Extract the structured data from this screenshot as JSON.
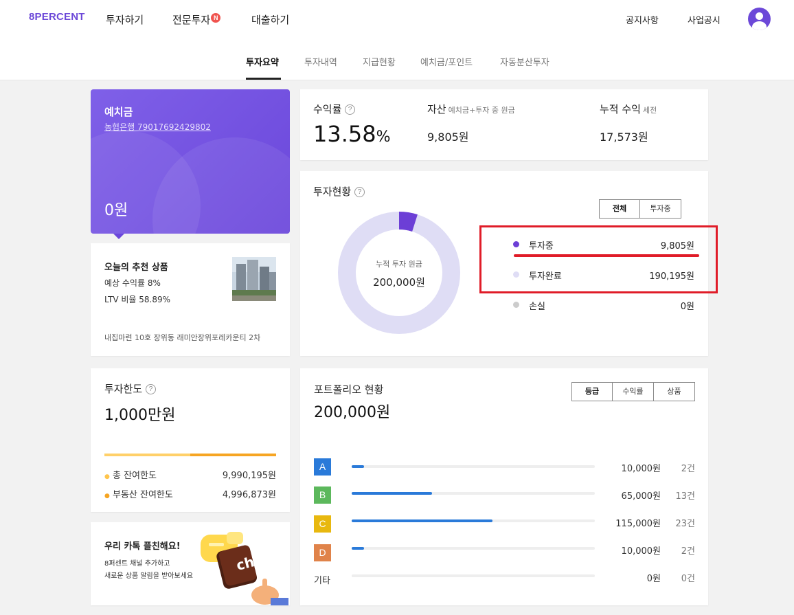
{
  "header": {
    "logo": "8PERCENT",
    "nav": [
      "투자하기",
      "전문투자",
      "대출하기"
    ],
    "nav_badge": "N",
    "right_nav": [
      "공지사항",
      "사업공시"
    ],
    "avatar_icon": "user-avatar-icon"
  },
  "tabs": [
    "투자요약",
    "투자내역",
    "지급현황",
    "예치금/포인트",
    "자동분산투자"
  ],
  "active_tab": "투자요약",
  "deposit": {
    "title": "예치금",
    "account": "농협은행 79017692429802",
    "amount": "0원"
  },
  "recommend": {
    "title": "오늘의 추천 상품",
    "rate": "예상 수익률 8%",
    "ltv": "LTV 비율 58.89%",
    "name": "내집마련 10호 장위동 래미안장위포레카운티 2차"
  },
  "summary": {
    "yield_label": "수익률",
    "yield_value": "13.58",
    "yield_unit": "%",
    "asset_label": "자산",
    "asset_sub": "예치금+투자 중 원금",
    "asset_value": "9,805원",
    "income_label": "누적 수익",
    "income_sub": "세전",
    "income_value": "17,573원"
  },
  "status": {
    "title": "투자현황",
    "toggle": [
      "전체",
      "투자중"
    ],
    "center_label": "누적 투자 원금",
    "center_value": "200,000원",
    "legend": [
      {
        "name": "투자중",
        "value": "9,805원",
        "color": "#6c3fd6"
      },
      {
        "name": "투자완료",
        "value": "190,195원",
        "color": "#dfddf5"
      },
      {
        "name": "손실",
        "value": "0원",
        "color": "#cccccc"
      }
    ],
    "donut_fraction_invest": 0.049
  },
  "limit": {
    "title": "투자한도",
    "value": "1,000만원",
    "total_label": "총 잔여한도",
    "total_value": "9,990,195원",
    "re_label": "부동산 잔여한도",
    "re_value": "4,996,873원"
  },
  "portfolio": {
    "title": "포트폴리오 현황",
    "total": "200,000원",
    "toggle": [
      "등급",
      "수익률",
      "상품"
    ],
    "rows": [
      {
        "grade": "A",
        "color": "#2a7ad9",
        "amount": "10,000원",
        "count": "2건",
        "fraction": 0.05
      },
      {
        "grade": "B",
        "color": "#5cb85c",
        "amount": "65,000원",
        "count": "13건",
        "fraction": 0.33
      },
      {
        "grade": "C",
        "color": "#e8b80f",
        "amount": "115,000원",
        "count": "23건",
        "fraction": 0.58
      },
      {
        "grade": "D",
        "color": "#e0834a",
        "amount": "10,000원",
        "count": "2건",
        "fraction": 0.05
      },
      {
        "grade": "기타",
        "color": "",
        "amount": "0원",
        "count": "0건",
        "fraction": 0
      }
    ]
  },
  "kakao": {
    "title": "우리 카톡 플친해요!",
    "line1": "8퍼센트 채널 추가하고",
    "line2": "새로운 상품 알림을 받아보세요",
    "logo_text": "ch"
  }
}
